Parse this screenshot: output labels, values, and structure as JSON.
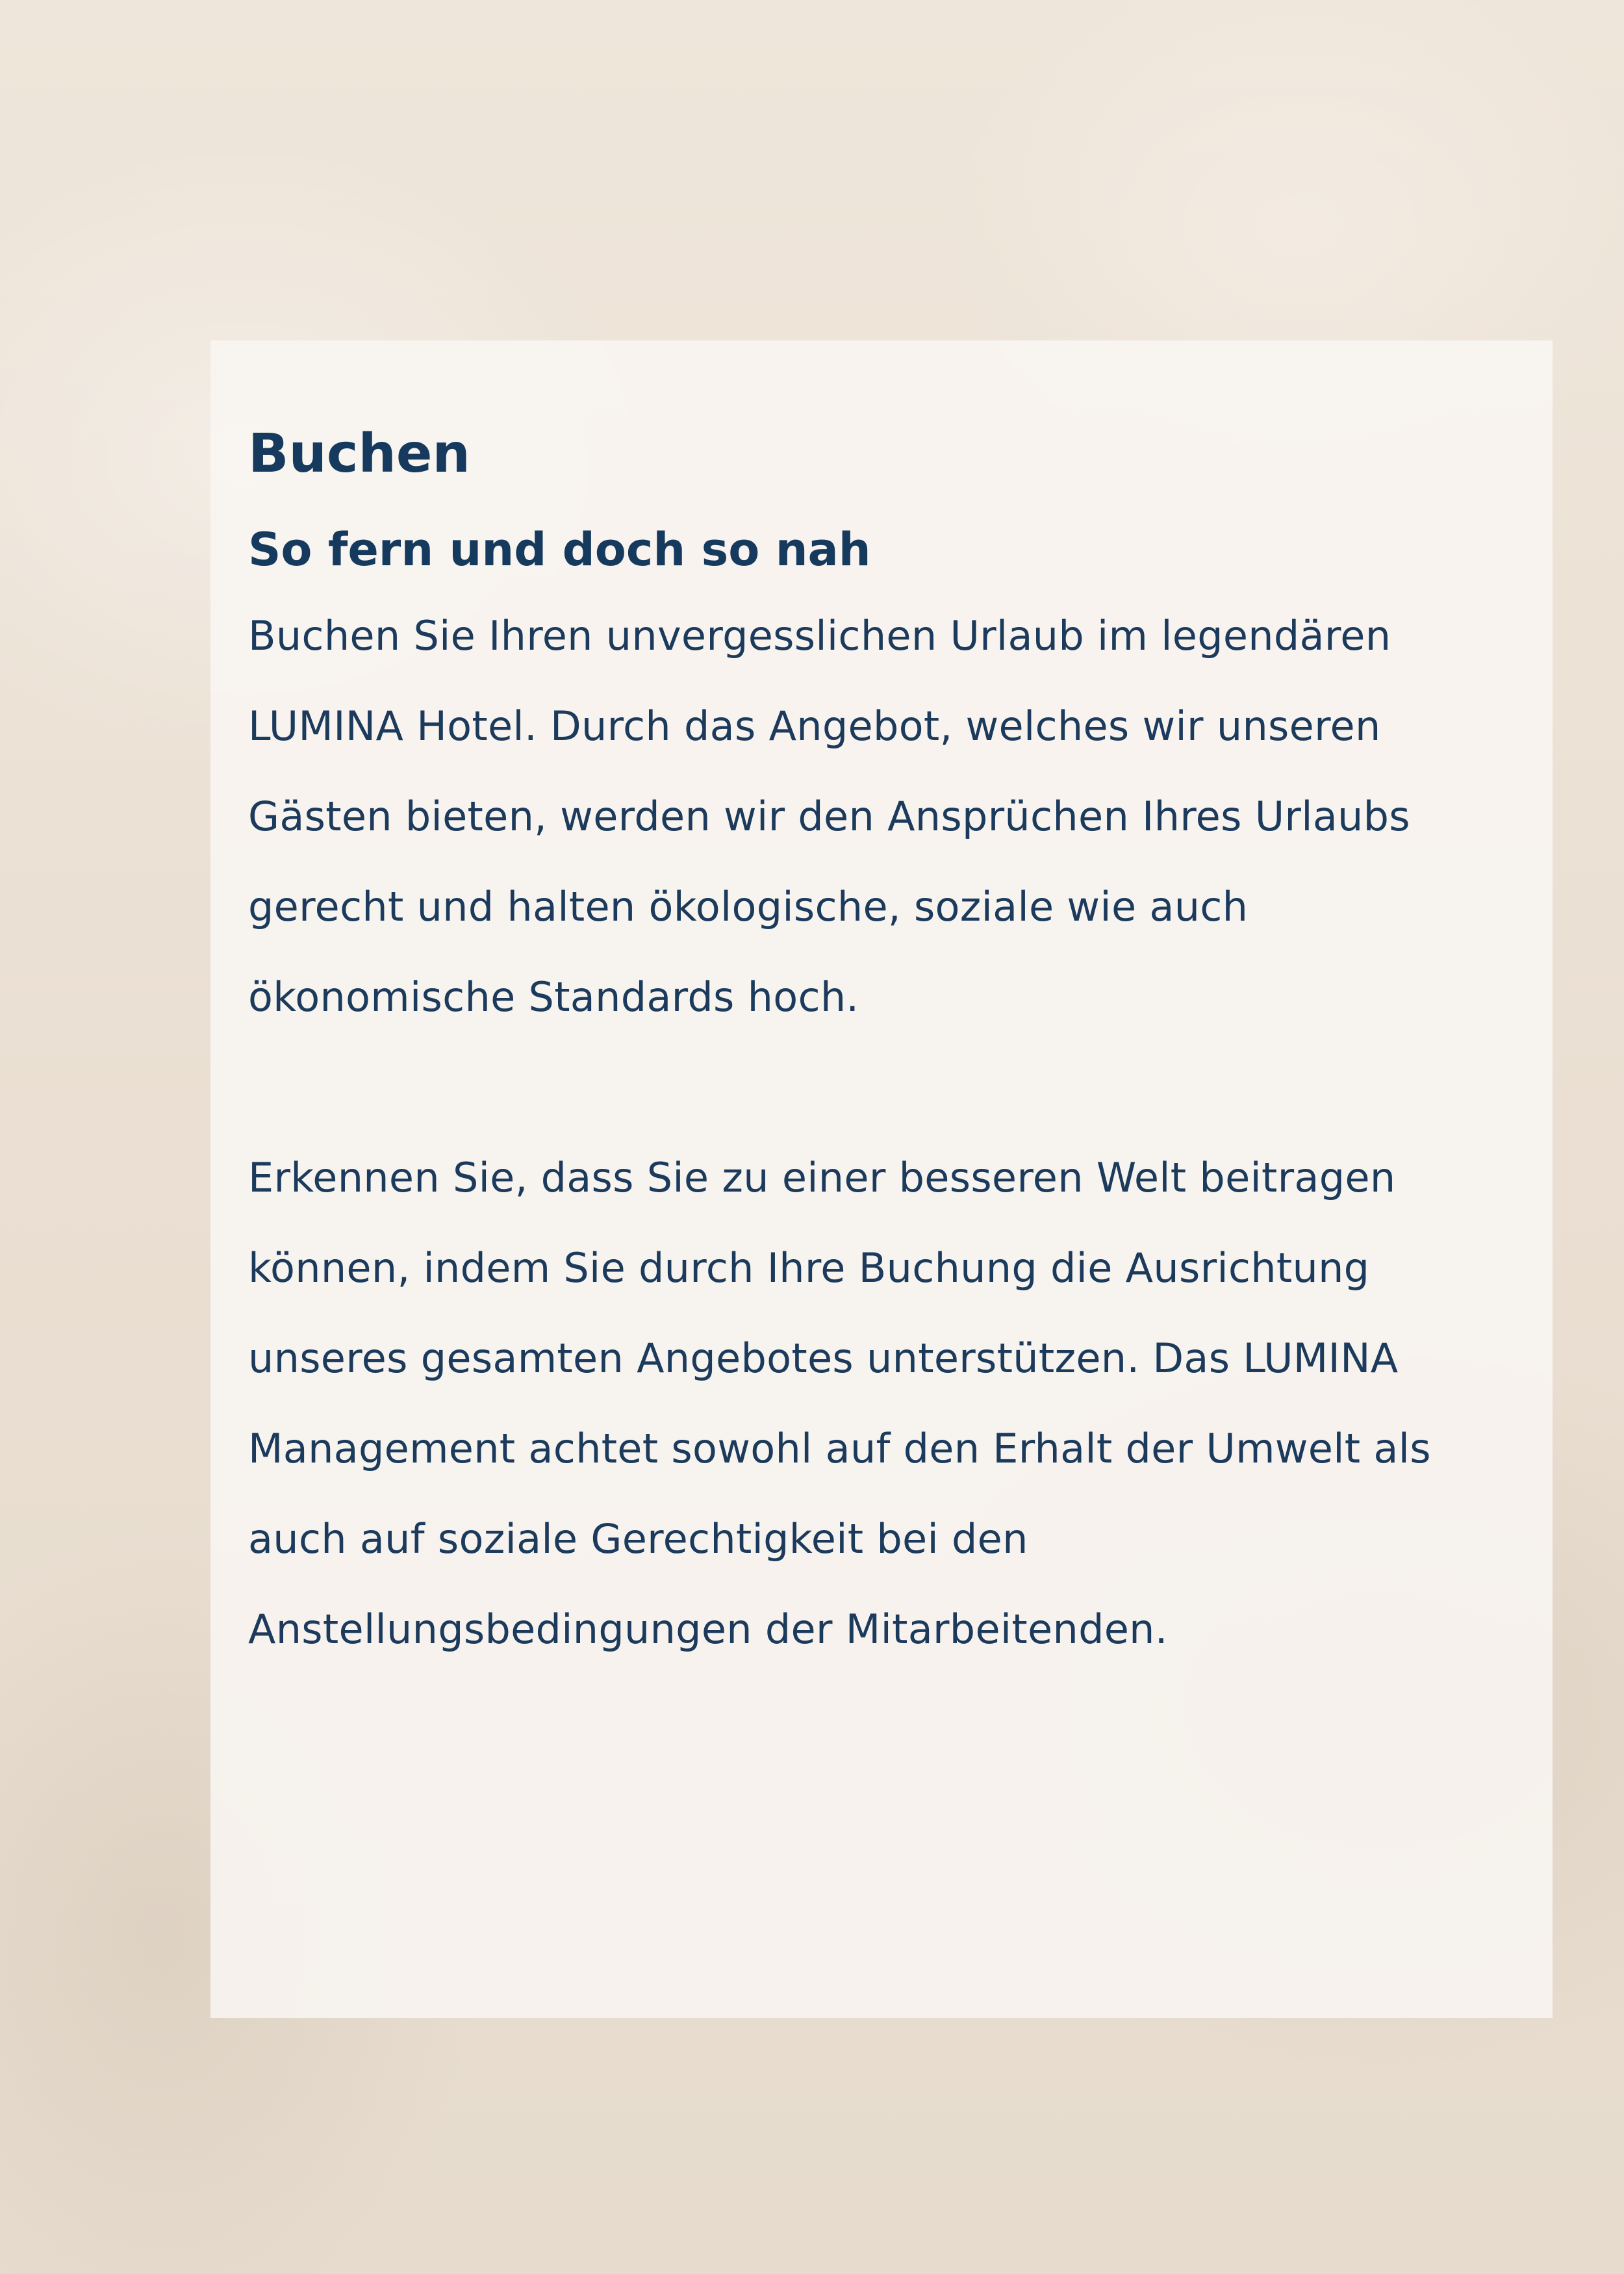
{
  "page": {
    "title": "Buchen",
    "subtitle": "So fern und doch so nah",
    "paragraphs": [
      "Buchen Sie Ihren unvergesslichen Urlaub im legendären LUMINA Hotel. Durch das Angebot, welches wir unseren Gästen bieten, werden wir den Ansprüchen Ihres Urlaubs gerecht und halten ökologische, soziale wie auch ökonomische Standards hoch.",
      "Erkennen Sie, dass Sie zu einer besseren Welt beitragen können, indem Sie durch Ihre Buchung die Ausrichtung unseres gesamten Angebotes unterstützen. Das LUMINA Management achtet sowohl auf den Erhalt der Umwelt als auch auf soziale Gerechtigkeit bei den Anstellungsbedingungen der Mitarbeitenden."
    ]
  },
  "colors": {
    "text": "#163a5e",
    "card_background": "#f9f6f2",
    "page_background": "#ede3d6"
  }
}
